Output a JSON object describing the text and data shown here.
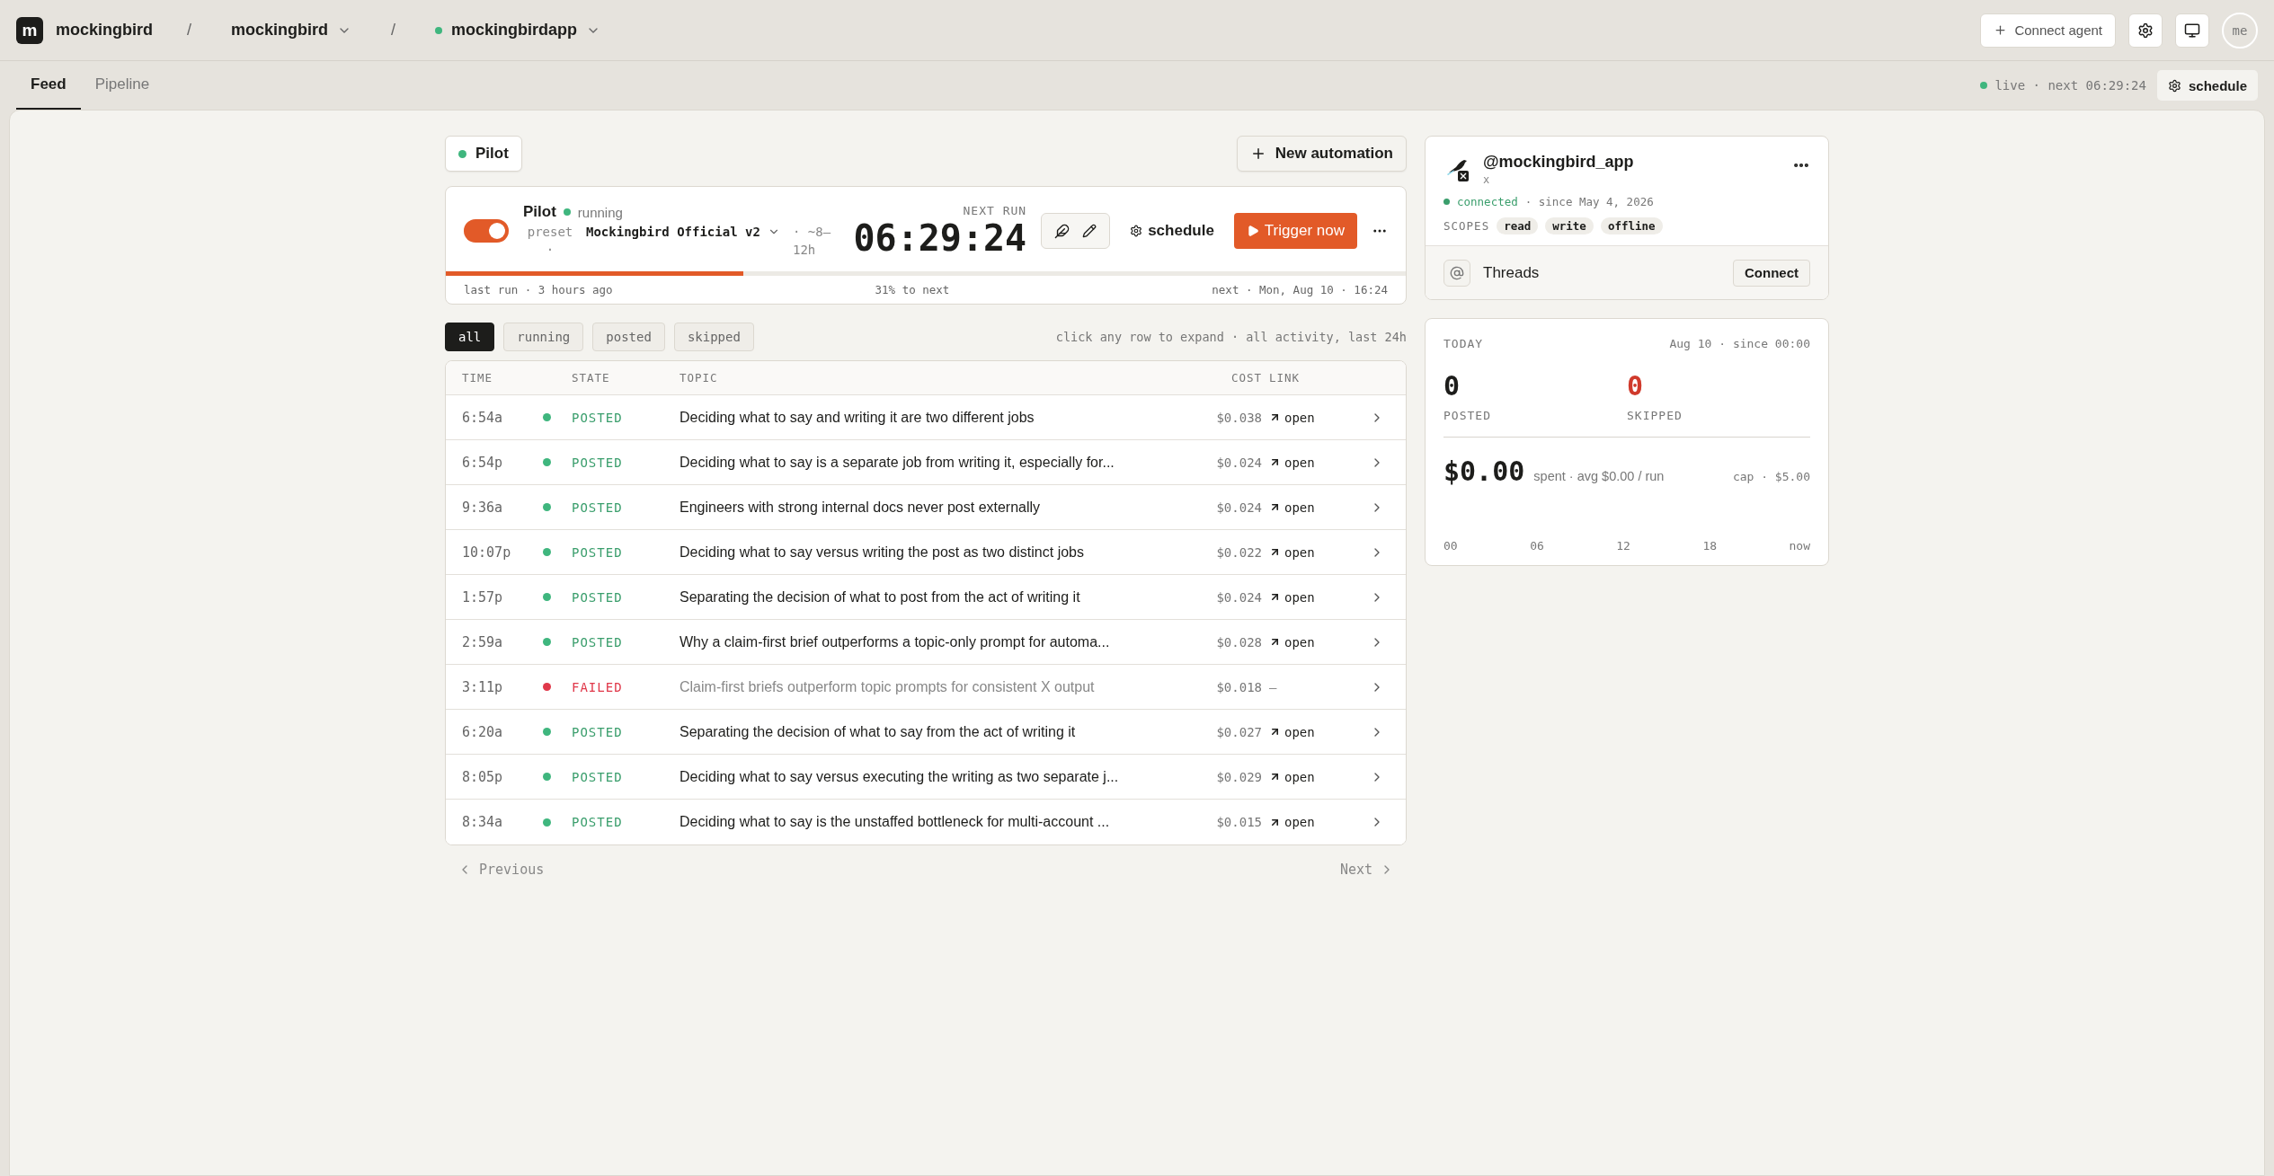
{
  "header": {
    "logo": "m",
    "workspace": "mockingbird",
    "separator_1": "/",
    "org": "mockingbird",
    "separator_2": "/",
    "project": "mockingbirdapp",
    "project_live": true,
    "connect_button": "Connect agent",
    "avatar": "me"
  },
  "tabs": [
    {
      "label": "Feed",
      "selected": true
    },
    {
      "label": "Pipeline",
      "selected": false
    }
  ],
  "status": {
    "live": true,
    "text": "live · next 06:29:24",
    "schedule_button": "schedule"
  },
  "automation_chip": {
    "label": "Pilot",
    "live": true
  },
  "new_automation": "New automation",
  "pilot": {
    "on": true,
    "name": "Pilot",
    "status": "running",
    "preset_label": "preset ·",
    "preset": "Mockingbird Official v2",
    "interval": "· ~8–12h",
    "next_run_label": "NEXT RUN",
    "next_run": "06:29:24",
    "schedule": "schedule",
    "trigger": "Trigger now",
    "progress": {
      "level": 0.31
    },
    "last_run": "last run · 3 hours ago",
    "progress_text": "31% to next",
    "next": "next · Mon, Aug 10 · 16:24"
  },
  "filters": [
    {
      "label": "all",
      "selected": true
    },
    {
      "label": "running",
      "selected": false
    },
    {
      "label": "posted",
      "selected": false
    },
    {
      "label": "skipped",
      "selected": false
    }
  ],
  "filter_hint": "click any row to expand · all activity, last 24h",
  "table": {
    "columns": [
      "TIME",
      "STATE",
      "TOPIC",
      "COST",
      "LINK"
    ],
    "rows": [
      {
        "time": "6:54a",
        "kind": "posted",
        "state": "POSTED",
        "topic": "Deciding what to say and writing it are two different jobs",
        "cost": "$0.038",
        "link": "open"
      },
      {
        "time": "6:54p",
        "kind": "posted",
        "state": "POSTED",
        "topic": "Deciding what to say is a separate job from writing it, especially for...",
        "cost": "$0.024",
        "link": "open"
      },
      {
        "time": "9:36a",
        "kind": "posted",
        "state": "POSTED",
        "topic": "Engineers with strong internal docs never post externally",
        "cost": "$0.024",
        "link": "open"
      },
      {
        "time": "10:07p",
        "kind": "posted",
        "state": "POSTED",
        "topic": "Deciding what to say versus writing the post as two distinct jobs",
        "cost": "$0.022",
        "link": "open"
      },
      {
        "time": "1:57p",
        "kind": "posted",
        "state": "POSTED",
        "topic": "Separating the decision of what to post from the act of writing it",
        "cost": "$0.024",
        "link": "open"
      },
      {
        "time": "2:59a",
        "kind": "posted",
        "state": "POSTED",
        "topic": "Why a claim-first brief outperforms a topic-only prompt for automa...",
        "cost": "$0.028",
        "link": "open"
      },
      {
        "time": "3:11p",
        "kind": "failed",
        "state": "FAILED",
        "topic": "Claim-first briefs outperform topic prompts for consistent X output",
        "cost": "$0.018",
        "link": "—"
      },
      {
        "time": "6:20a",
        "kind": "posted",
        "state": "POSTED",
        "topic": "Separating the decision of what to say from the act of writing it",
        "cost": "$0.027",
        "link": "open"
      },
      {
        "time": "8:05p",
        "kind": "posted",
        "state": "POSTED",
        "topic": "Deciding what to say versus executing the writing as two separate j...",
        "cost": "$0.029",
        "link": "open"
      },
      {
        "time": "8:34a",
        "kind": "posted",
        "state": "POSTED",
        "topic": "Deciding what to say is the unstaffed bottleneck for multi-account ...",
        "cost": "$0.015",
        "link": "open"
      }
    ]
  },
  "pagination": {
    "previous": "Previous",
    "next": "Next"
  },
  "account": {
    "handle": "@mockingbird_app",
    "network": "x",
    "connected": true,
    "status": "connected",
    "since": "· since May 4, 2026",
    "scopes_label": "SCOPES",
    "scopes": [
      "read",
      "write",
      "offline"
    ],
    "threads": "Threads",
    "connect": "Connect"
  },
  "today": {
    "label": "TODAY",
    "range": "Aug 10 · since 00:00",
    "stats": [
      {
        "value": "0",
        "label": "POSTED",
        "kind": "neutral"
      },
      {
        "value": "0",
        "label": "SKIPPED",
        "kind": "alert"
      }
    ],
    "spent": "$0.00",
    "spent_detail": "spent · avg $0.00 / run",
    "cap": "cap · $5.00",
    "axis": [
      "00",
      "06",
      "12",
      "18",
      "now"
    ]
  }
}
